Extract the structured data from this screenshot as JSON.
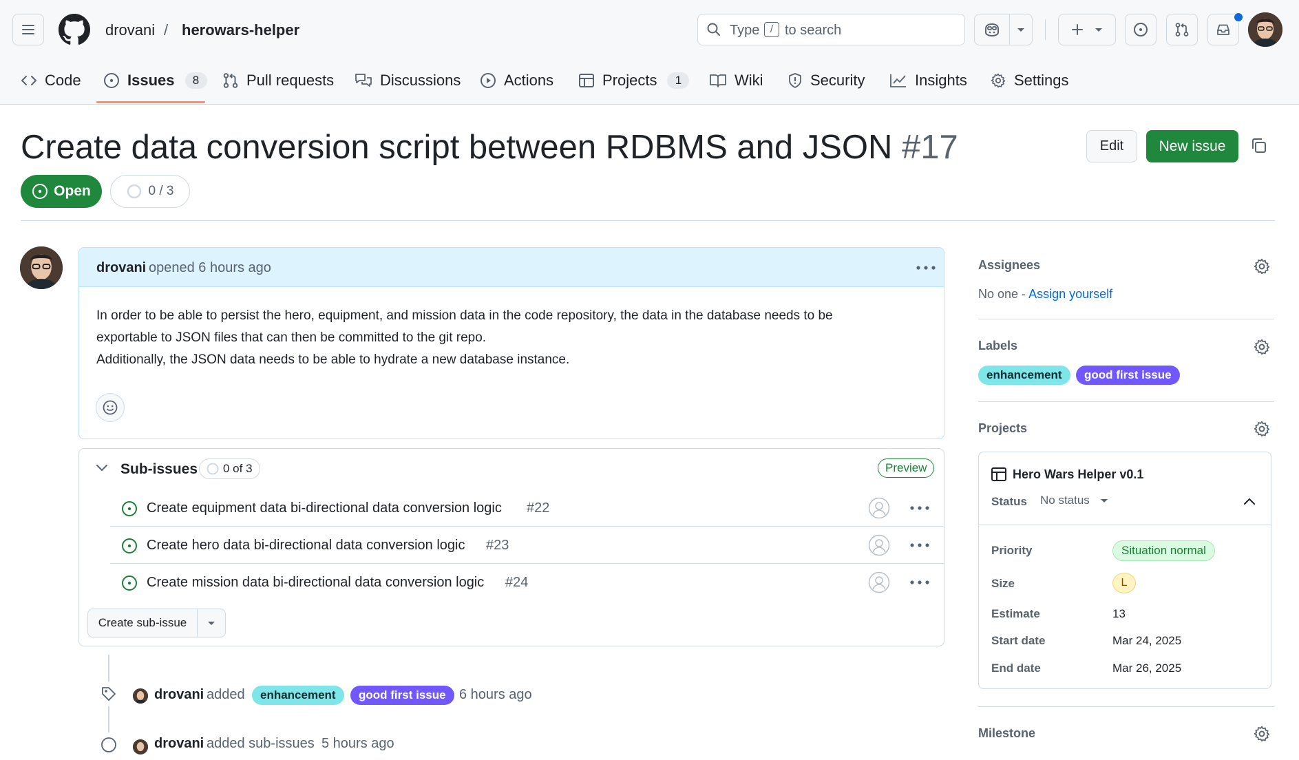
{
  "header": {
    "owner": "drovani",
    "separator": "/",
    "repo": "herowars-helper",
    "search": {
      "type_label": "Type",
      "slash_key": "/",
      "suffix": "to search"
    }
  },
  "tabs": [
    {
      "label": "Code"
    },
    {
      "label": "Issues",
      "count": "8"
    },
    {
      "label": "Pull requests"
    },
    {
      "label": "Discussions"
    },
    {
      "label": "Actions"
    },
    {
      "label": "Projects",
      "count": "1"
    },
    {
      "label": "Wiki"
    },
    {
      "label": "Security"
    },
    {
      "label": "Insights"
    },
    {
      "label": "Settings"
    }
  ],
  "issue": {
    "title": "Create data conversion script between RDBMS and JSON",
    "number": "#17",
    "state": "Open",
    "progress": "0 / 3",
    "edit_label": "Edit",
    "new_issue_label": "New issue"
  },
  "comment": {
    "author": "drovani",
    "meta": "opened 6 hours ago",
    "body": [
      "In order to be able to persist the hero, equipment, and mission data in the code repository, the data in the database needs to be",
      "exportable to JSON files that can then be committed to the git repo.",
      "Additionally, the JSON data needs to be able to hydrate a new database instance."
    ]
  },
  "subissues": {
    "title": "Sub-issues",
    "progress": "0 of 3",
    "preview_label": "Preview",
    "items": [
      {
        "title": "Create equipment data bi-directional data conversion logic",
        "number": "#22"
      },
      {
        "title": "Create hero data bi-directional data conversion logic",
        "number": "#23"
      },
      {
        "title": "Create mission data bi-directional data conversion logic",
        "number": "#24"
      }
    ],
    "create_label": "Create sub-issue"
  },
  "timeline": [
    {
      "author": "drovani",
      "action": "added",
      "labels": [
        "enhancement",
        "good first issue"
      ],
      "time": "6 hours ago"
    },
    {
      "author": "drovani",
      "action": "added sub-issues",
      "time": "5 hours ago"
    }
  ],
  "sidebar": {
    "assignees": {
      "title": "Assignees",
      "none": "No one -",
      "assign_link": "Assign yourself"
    },
    "labels": {
      "title": "Labels",
      "items": [
        "enhancement",
        "good first issue"
      ]
    },
    "projects": {
      "title": "Projects",
      "project_name": "Hero Wars Helper v0.1",
      "status_key": "Status",
      "status_value": "No status",
      "fields": [
        {
          "key": "Priority",
          "value": "Situation normal"
        },
        {
          "key": "Size",
          "value": "L"
        },
        {
          "key": "Estimate",
          "value": "13"
        },
        {
          "key": "Start date",
          "value": "Mar 24, 2025"
        },
        {
          "key": "End date",
          "value": "Mar 26, 2025"
        }
      ]
    },
    "milestone": {
      "title": "Milestone"
    }
  },
  "colors": {
    "open_green": "#1f883d",
    "accent_blue": "#0969da",
    "label_enhancement": "#7ee5e8",
    "label_good_first_issue": "#7057ff",
    "comment_header_bg": "#ddf4ff"
  }
}
